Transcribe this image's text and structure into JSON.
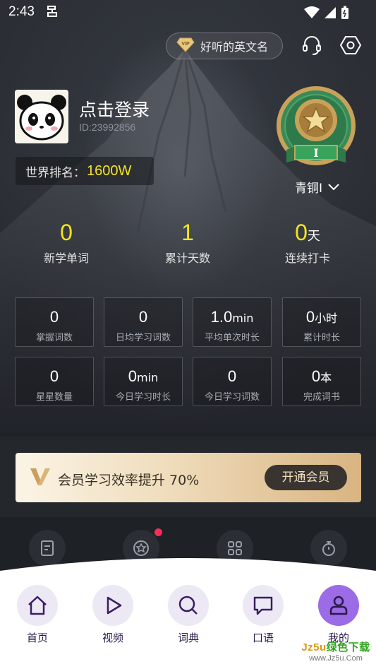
{
  "status_bar": {
    "time": "2:43"
  },
  "header": {
    "vip_name_label": "好听的英文名"
  },
  "profile": {
    "login_text": "点击登录",
    "user_id": "ID:23992856",
    "rank_label": "世界排名：",
    "rank_value": "1600W",
    "level_text": "青铜I"
  },
  "stats": [
    {
      "value": "0",
      "unit": "",
      "label": "新学单词"
    },
    {
      "value": "1",
      "unit": "",
      "label": "累计天数"
    },
    {
      "value": "0",
      "unit": "天",
      "label": "连续打卡"
    }
  ],
  "cards": [
    {
      "value": "0",
      "unit": "",
      "label": "掌握词数"
    },
    {
      "value": "0",
      "unit": "",
      "label": "日均学习词数"
    },
    {
      "value": "1.0",
      "unit": "min",
      "label": "平均单次时长"
    },
    {
      "value": "0",
      "unit": "小时",
      "label": "累计时长"
    },
    {
      "value": "0",
      "unit": "",
      "label": "星星数量"
    },
    {
      "value": "0",
      "unit": "min",
      "label": "今日学习时长"
    },
    {
      "value": "0",
      "unit": "",
      "label": "今日学习词数"
    },
    {
      "value": "0",
      "unit": "本",
      "label": "完成词书"
    }
  ],
  "promo": {
    "text": "会员学习效率提升 70%",
    "button": "开通会员"
  },
  "tools": [
    {
      "icon": "document-icon"
    },
    {
      "icon": "medal-icon",
      "has_dot": true
    },
    {
      "icon": "grid-icon"
    },
    {
      "icon": "stopwatch-icon"
    }
  ],
  "nav": [
    {
      "label": "首页",
      "icon": "home-icon",
      "active": false
    },
    {
      "label": "视频",
      "icon": "play-icon",
      "active": false
    },
    {
      "label": "词典",
      "icon": "search-icon",
      "active": false
    },
    {
      "label": "口语",
      "icon": "chat-icon",
      "active": false
    },
    {
      "label": "我的",
      "icon": "user-icon",
      "active": true
    }
  ],
  "watermark": {
    "prefix": "Jz5u",
    "main": "绿色下载",
    "sub": "www.Jz5u.Com"
  },
  "colors": {
    "accent_yellow": "#f3e41f",
    "nav_active": "#9c6be6",
    "badge_green": "#2f8a4a",
    "badge_gold": "#c9a25a"
  }
}
